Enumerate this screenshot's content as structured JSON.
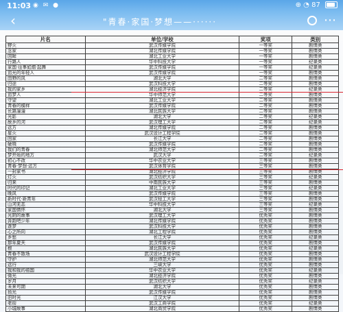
{
  "status_bar": {
    "time": "11:03",
    "icons": "◉ ✉ ●",
    "right": "⊕ ◔ 87"
  },
  "title_bar": {
    "back_icon": "back-arrow-icon",
    "title": "\"青春·家国·梦想——······",
    "more_icon": "more-icon"
  },
  "table": {
    "headers": [
      "片名",
      "单位/学校",
      "奖项",
      "类别"
    ],
    "rows": [
      [
        "野火",
        "武汉传媒学院",
        "一等奖",
        "剧情类"
      ],
      [
        "念家",
        "湖北传媒学院",
        "一等奖",
        "剧情类"
      ],
      [
        "回眸",
        "湖北工业大学",
        "一等奖",
        "剧情类"
      ],
      [
        "行路人",
        "华中科技大学",
        "一等奖",
        "纪录类"
      ],
      [
        "家国·往事如烟·起舞",
        "武汉传媒学院",
        "一等奖",
        "纪录类"
      ],
      [
        "追光的年轻人",
        "武汉传媒学院",
        "一等奖",
        "剧情类"
      ],
      [
        "田野的风",
        "湖北大学",
        "二等奖",
        "剧情类"
      ],
      [
        "归途",
        "武汉科技大学",
        "二等奖",
        "剧情类"
      ],
      [
        "我的家乡",
        "湖北经济学院",
        "二等奖",
        "纪录类"
      ],
      [
        "追梦人",
        "华中师范大学",
        "二等奖",
        "剧情类"
      ],
      [
        "守望",
        "湖北工业大学",
        "二等奖",
        "剧情类"
      ],
      [
        "青春的模样",
        "武汉传媒学院",
        "二等奖",
        "剧情类"
      ],
      [
        "长路漫漫",
        "湖北民族大学",
        "二等奖",
        "剧情类"
      ],
      [
        "光影",
        "湖北大学",
        "二等奖",
        "纪录类"
      ],
      [
        "故乡的河",
        "武汉理工大学",
        "二等奖",
        "纪录类"
      ],
      [
        "远方",
        "湖北传媒学院",
        "二等奖",
        "剧情类"
      ],
      [
        "星火",
        "武汉设计工程学院",
        "二等奖",
        "剧情类"
      ],
      [
        "回家",
        "长江大学",
        "二等奖",
        "剧情类"
      ],
      [
        "破晓",
        "武汉传媒学院",
        "二等奖",
        "剧情类"
      ],
      [
        "我们的青春",
        "湖北师范大学",
        "二等奖",
        "剧情类"
      ],
      [
        "梦开始的地方",
        "武汉大学",
        "二等奖",
        "纪录类"
      ],
      [
        "初心不改",
        "华中农业大学",
        "三等奖",
        "剧情类"
      ],
      [
        "青春·梦想·远方",
        "武汉体育学院",
        "三等奖",
        "剧情类"
      ],
      [
        "一封家书",
        "湖北经济学院",
        "三等奖",
        "剧情类"
      ],
      [
        "灯火",
        "武汉纺织大学",
        "三等奖",
        "纪录类"
      ],
      [
        "归来",
        "中南民族大学",
        "三等奖",
        "剧情类"
      ],
      [
        "时代的印记",
        "湖北工业大学",
        "三等奖",
        "纪录类"
      ],
      [
        "晚风",
        "武汉传媒学院",
        "三等奖",
        "剧情类"
      ],
      [
        "新时代·新青年",
        "武汉轻工大学",
        "三等奖",
        "剧情类"
      ],
      [
        "山河无恙",
        "华中科技大学",
        "三等奖",
        "纪录类"
      ],
      [
        "家国情怀",
        "湖北大学",
        "三等奖",
        "剧情类"
      ],
      [
        "光阴的故事",
        "武汉理工大学",
        "优秀奖",
        "剧情类"
      ],
      [
        "奔跑吧少年",
        "湖北传媒学院",
        "优秀奖",
        "剧情类"
      ],
      [
        "逐梦",
        "武汉科技大学",
        "优秀奖",
        "剧情类"
      ],
      [
        "心之所向",
        "湖北工程学院",
        "优秀奖",
        "剧情类"
      ],
      [
        "乡愁",
        "长江大学",
        "优秀奖",
        "纪录类"
      ],
      [
        "那年夏天",
        "武汉传媒学院",
        "优秀奖",
        "剧情类"
      ],
      [
        "根",
        "湖北民族大学",
        "优秀奖",
        "纪录类"
      ],
      [
        "青春不散场",
        "武汉设计工程学院",
        "优秀奖",
        "剧情类"
      ],
      [
        "守护",
        "湖北师范大学",
        "优秀奖",
        "剧情类"
      ],
      [
        "远行",
        "三峡大学",
        "优秀奖",
        "剧情类"
      ],
      [
        "我和我的祖国",
        "华中农业大学",
        "优秀奖",
        "纪录类"
      ],
      [
        "微光",
        "湖北经济学院",
        "优秀奖",
        "剧情类"
      ],
      [
        "岁月",
        "武汉纺织大学",
        "优秀奖",
        "纪录类"
      ],
      [
        "未来可期",
        "湖北大学",
        "优秀奖",
        "剧情类"
      ],
      [
        "拾光",
        "武汉传媒学院",
        "优秀奖",
        "剧情类"
      ],
      [
        "旧时光",
        "江汉大学",
        "优秀奖",
        "剧情类"
      ],
      [
        "老街",
        "武汉工商学院",
        "优秀奖",
        "纪录类"
      ],
      [
        "小城故事",
        "湖北商贸学院",
        "优秀奖",
        "剧情类"
      ]
    ]
  }
}
